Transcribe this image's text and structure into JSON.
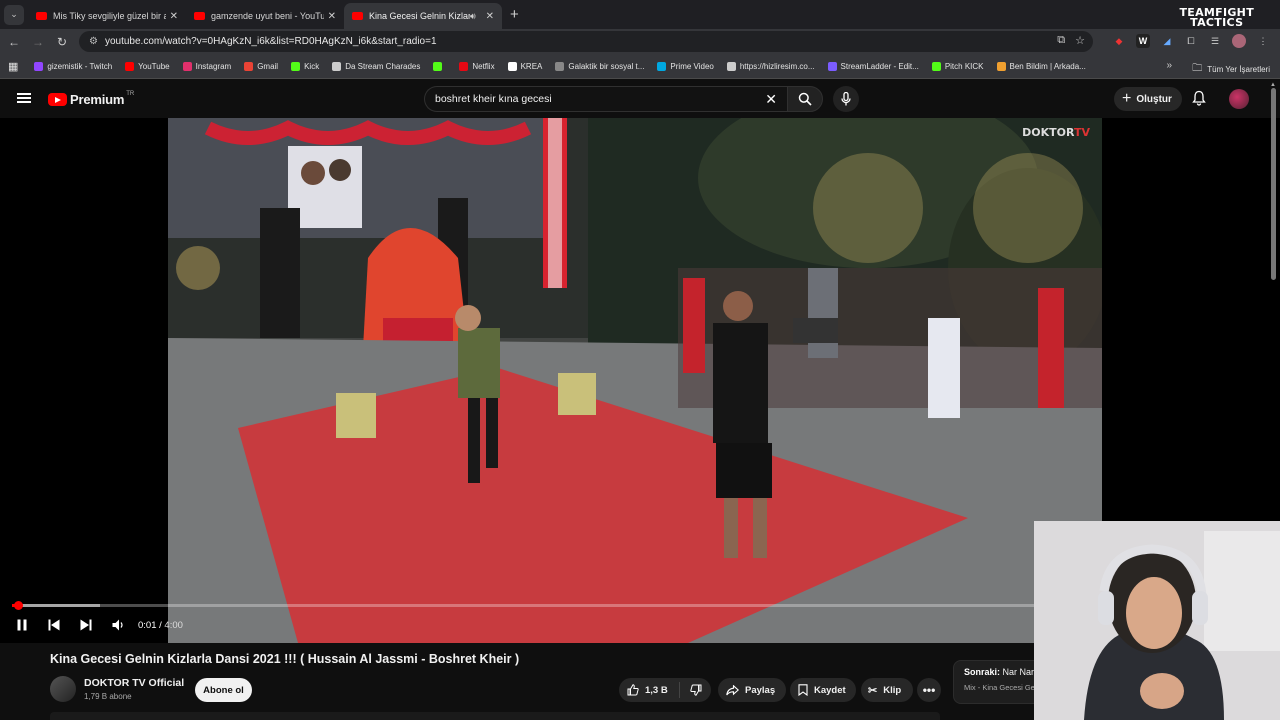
{
  "browser": {
    "tabs": [
      {
        "title": "Mis Tiky sevgiliyle güzel bir ara",
        "active": false
      },
      {
        "title": "gamzende uyut beni - YouTube",
        "active": false
      },
      {
        "title": "Kina Gecesi Gelnin Kizlarla",
        "active": true
      }
    ],
    "address": "youtube.com/watch?v=0HAgKzN_i6k&list=RD0HAgKzN_i6k&start_radio=1",
    "overlay_logo_line1": "TEAMFIGHT",
    "overlay_logo_line2": "TACTICS",
    "bookmarks": [
      {
        "label": "gizemistik - Twitch",
        "color": "#9146ff"
      },
      {
        "label": "YouTube",
        "color": "#ff0000"
      },
      {
        "label": "Instagram",
        "color": "#e1306c"
      },
      {
        "label": "Gmail",
        "color": "#ea4335"
      },
      {
        "label": "Kick",
        "color": "#53fc18"
      },
      {
        "label": "Da Stream Charades",
        "color": "#cccccc"
      },
      {
        "label": "",
        "color": "#53fc18"
      },
      {
        "label": "Netflix",
        "color": "#e50914"
      },
      {
        "label": "KREA",
        "color": "#ffffff"
      },
      {
        "label": "Galaktik bir sosyal t...",
        "color": "#888888"
      },
      {
        "label": "Prime Video",
        "color": "#00a8e1"
      },
      {
        "label": "https://hizliresim.co...",
        "color": "#cccccc"
      },
      {
        "label": "StreamLadder - Edit...",
        "color": "#7b5cff"
      },
      {
        "label": "Pitch KICK",
        "color": "#53fc18"
      },
      {
        "label": "Ben Bildim | Arkada...",
        "color": "#f0a030"
      }
    ],
    "all_bookmarks": "Tüm Yer İşaretleri"
  },
  "youtube": {
    "logo": "Premium",
    "region": "TR",
    "search_query": "boshret kheir kına gecesi",
    "create_label": "Oluştur",
    "video": {
      "watermark_a": "DOKTOR",
      "watermark_b": "TV",
      "time_current": "0:01",
      "time_total": "4:00",
      "progress_played": 0.004,
      "progress_loaded": 0.086
    },
    "title": "Kina Gecesi Gelnin Kizlarla Dansi 2021 !!! ( Hussain Al Jassmi - Boshret Kheir )",
    "channel": "DOKTOR TV Official",
    "subscribers": "1,79 B abone",
    "subscribe_label": "Abone ol",
    "likes": "1,3 B",
    "share_label": "Paylaş",
    "save_label": "Kaydet",
    "clip_label": "Klip",
    "next": {
      "prefix": "Sonraki:",
      "title": "Nar Nar",
      "subtitle": "Mix - Kina Gecesi Gelni"
    }
  },
  "colors": {
    "accent": "#ff0000",
    "background": "#0f0f0f"
  }
}
